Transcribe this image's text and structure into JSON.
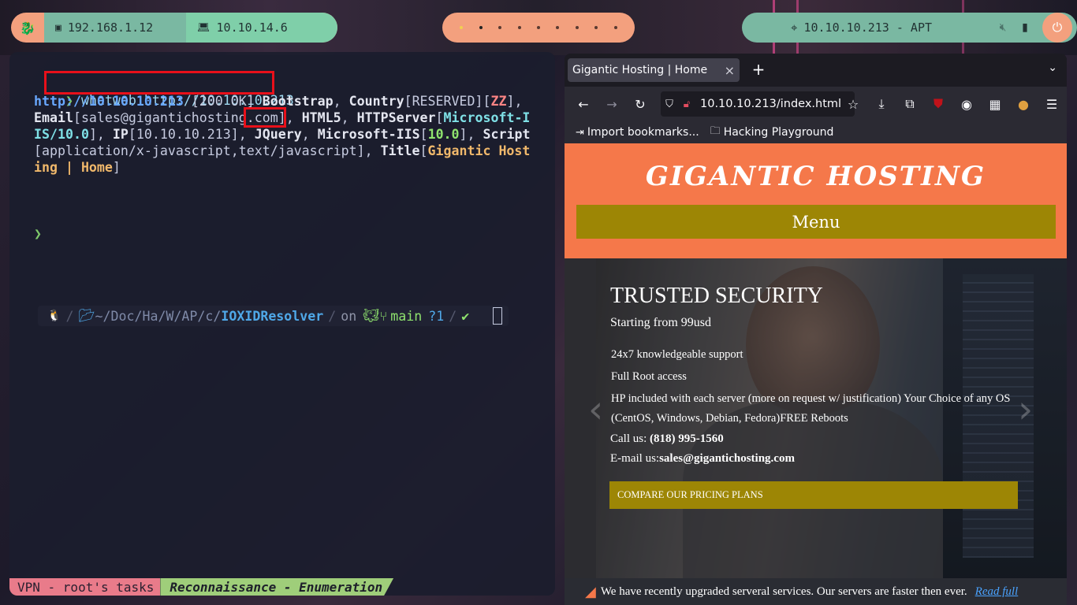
{
  "topbar": {
    "host_ip": "192.168.1.12",
    "vpn_ip": "10.10.14.6",
    "target": "10.10.10.213 - APT",
    "workspaces": 9,
    "icons": [
      "kali-dragon-icon",
      "monitor-icon",
      "laptop-icon",
      "crosshair-icon",
      "speaker-mute-icon",
      "battery-icon",
      "power-icon"
    ]
  },
  "terminal": {
    "prompt_symbol": "❯",
    "command": "whatweb http://10.10.10.213",
    "output": {
      "l1a": "http://10.10.10.213",
      "l1b": " [200 OK] ",
      "l1c": "Bootstrap",
      "l1d": ", ",
      "l1e": "Country",
      "l1f": "[RESERVED][",
      "l1g": "ZZ",
      "l1h": "],",
      "l2a": "Email",
      "l2b": "[sales@gigantichosting.com]",
      "l2c": ", ",
      "l2d": "HTML5",
      "l2e": ", ",
      "l2f": "HTTPServer",
      "l2g": "[",
      "l2h": "Microsoft-I",
      "l3a": "IS/10.0",
      "l3b": "], ",
      "l3c": "IP",
      "l3d": "[10.10.10.213], ",
      "l3e": "JQuery",
      "l3f": ", ",
      "l3g": "Microsoft-IIS",
      "l3h": "[",
      "l3i": "10.0",
      "l3j": "], ",
      "l3k": "Script",
      "l4a": "[application/x-javascript,text/javascript], ",
      "l4b": "Title",
      "l4c": "[",
      "l4d": "Gigantic Host",
      "l5a": "ing | Home",
      "l5b": "]"
    },
    "prompt_bar": {
      "os_icon": "🐧",
      "path_prefix": "~/Doc/Ha/W/AP/c/",
      "path_dir": "IOXIDResolver",
      "on": "on",
      "branch": "main",
      "status": "?1",
      "check": "✔"
    },
    "statusbar": {
      "session": "VPN - root's tasks",
      "window": "Reconnaissance - Enumeration"
    }
  },
  "browser": {
    "tab_title": "Gigantic Hosting | Home",
    "tab_close": "×",
    "new_tab": "+",
    "url": "10.10.10.213/index.html",
    "bookmarks": [
      {
        "label": "Import bookmarks..."
      },
      {
        "label": "Hacking Playground"
      }
    ],
    "page": {
      "logo": "GIGANTIC HOSTING",
      "menu": "Menu",
      "hero_title": "TRUSTED SECURITY",
      "hero_subtitle": "Starting from 99usd",
      "features": [
        "24x7 knowledgeable support",
        "Full Root access",
        "HP included with each server (more on request w/ justification) Your Choice of any OS",
        "(CentOS, Windows, Debian, Fedora)FREE Reboots"
      ],
      "call_label": "Call us: ",
      "phone": "(818) 995-1560",
      "email_label": "E-mail us:",
      "email": "sales@gigantichosting.com",
      "cta": "COMPARE OUR PRICING PLANS",
      "news_text": "We have recently upgraded serveral services. Our servers are faster then ever.",
      "news_link": "Read full"
    }
  },
  "colors": {
    "accent_orange": "#f5784a",
    "olive": "#9d8605",
    "highlight_red": "#e8101a"
  }
}
